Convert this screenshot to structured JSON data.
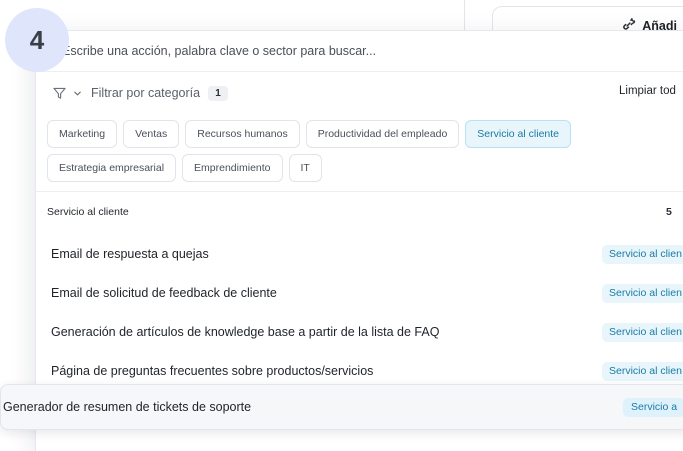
{
  "background": {
    "add_button_label": "Añadi"
  },
  "step_badge": "4",
  "search": {
    "placeholder": "Escribe una acción, palabra clave o sector para buscar...",
    "value": ""
  },
  "filter": {
    "label": "Filtrar por categoría",
    "count": "1",
    "clear_label": "Limpiar tod"
  },
  "categories": [
    [
      "Marketing",
      "Ventas",
      "Recursos humanos",
      "Productividad del empleado",
      "Servicio al cliente"
    ],
    [
      "Estrategia empresarial",
      "Emprendimiento",
      "IT"
    ]
  ],
  "active_category": "Servicio al cliente",
  "group": {
    "title": "Servicio al cliente",
    "count": "5"
  },
  "results": [
    {
      "title": "Email de respuesta a quejas",
      "tag": "Servicio al clien"
    },
    {
      "title": "Email de solicitud de feedback de cliente",
      "tag": "Servicio al clien"
    },
    {
      "title": "Generación de artículos de knowledge base a partir de la lista de FAQ",
      "tag": "Servicio al clien"
    },
    {
      "title": "Página de preguntas frecuentes sobre productos/servicios",
      "tag": "Servicio al clien"
    }
  ],
  "hovered_result": {
    "title": "Generador de resumen de tickets de soporte",
    "tag": "Servicio a"
  },
  "colors": {
    "accent": "#1a7aa3",
    "accent_bg": "#e8f6fc",
    "badge_bg": "#dfe6fb"
  },
  "icons": {
    "add": "link-plus-icon",
    "filter": "funnel-icon",
    "chevron": "chevron-down-icon"
  }
}
